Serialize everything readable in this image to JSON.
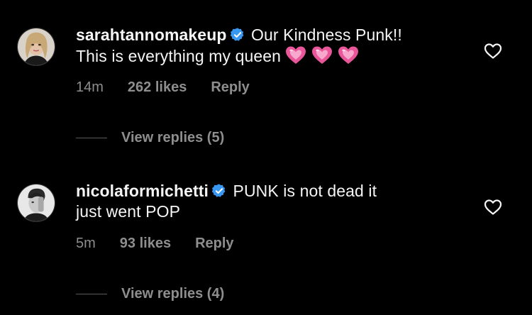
{
  "comments": [
    {
      "username": "sarahtannomakeup",
      "text_line1": "Our Kindness Punk!!",
      "text_line2": "This is everything my queen",
      "emoji": [
        "pink-heart",
        "pink-heart",
        "pink-heart"
      ],
      "time": "14m",
      "likes": "262 likes",
      "reply_label": "Reply",
      "view_replies": "View replies (5)",
      "verified": true
    },
    {
      "username": "nicolaformichetti",
      "text_line1": "PUNK is not dead it",
      "text_line2": "just went POP",
      "time": "5m",
      "likes": "93 likes",
      "reply_label": "Reply",
      "view_replies": "View replies (4)",
      "verified": true
    }
  ],
  "colors": {
    "background": "#000000",
    "primary_text": "#f5f5f5",
    "secondary_text": "#8e8e8e",
    "verified_blue": "#3897f0",
    "heart_pink": "#e9579a"
  },
  "icons": {
    "verified": "verified-badge-icon",
    "like": "heart-outline-icon"
  }
}
